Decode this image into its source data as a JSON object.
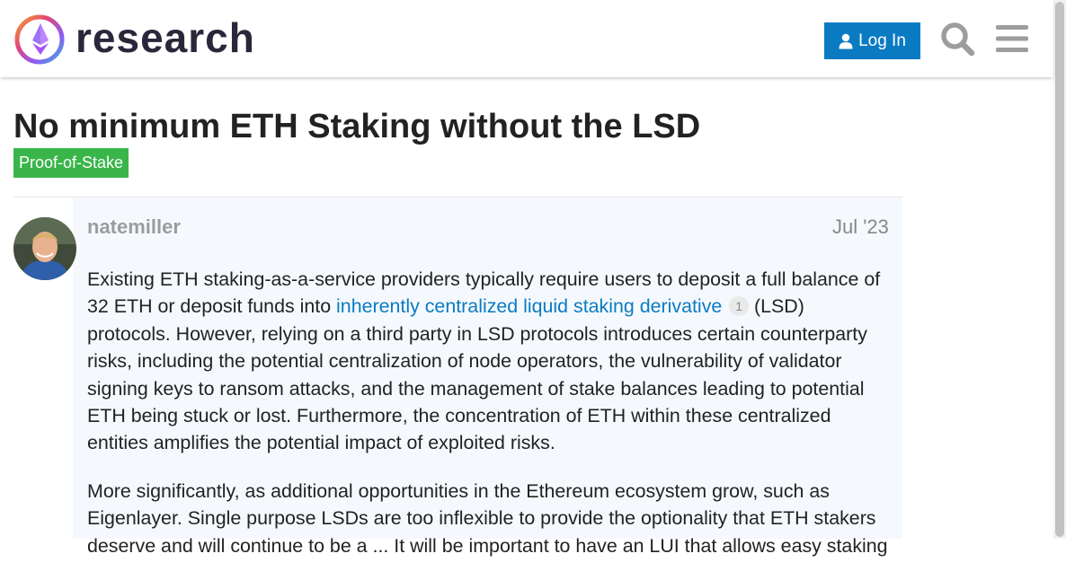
{
  "header": {
    "brand": "research",
    "login_label": "Log In",
    "icons": [
      "ethereum-logo",
      "user-icon",
      "search-icon",
      "hamburger-menu-icon"
    ]
  },
  "topic": {
    "title": "No minimum ETH Staking without the LSD",
    "category": "Proof-of-Stake",
    "category_color": "#3ab54a"
  },
  "post": {
    "username": "natemiller",
    "date": "Jul '23",
    "p1_before_link": "Existing ETH staking-as-a-service providers typically require users to deposit a full balance of 32 ETH or deposit funds into ",
    "p1_link": "inherently centralized liquid staking derivative",
    "p1_link_clicks": "1",
    "p1_after_link": " (LSD) protocols. However, relying on a third party in LSD protocols introduces certain counterparty risks, including the potential centralization of node operators, the vulnerability of validator signing keys to ransom attacks, and the management of stake balances leading to potential ETH being stuck or lost. Furthermore, the concentration of ETH within these centralized entities amplifies the potential impact of exploited risks.",
    "p2": "More significantly, as additional opportunities in the Ethereum ecosystem grow, such as Eigenlayer. Single purpose LSDs are too inflexible to provide the optionality that ETH stakers deserve and will continue to be a ... It will be important to have an LUI that allows easy staking"
  },
  "colors": {
    "accent": "#0a7bc2",
    "post_background": "#f5f9fd",
    "brand_text": "#29283a"
  }
}
